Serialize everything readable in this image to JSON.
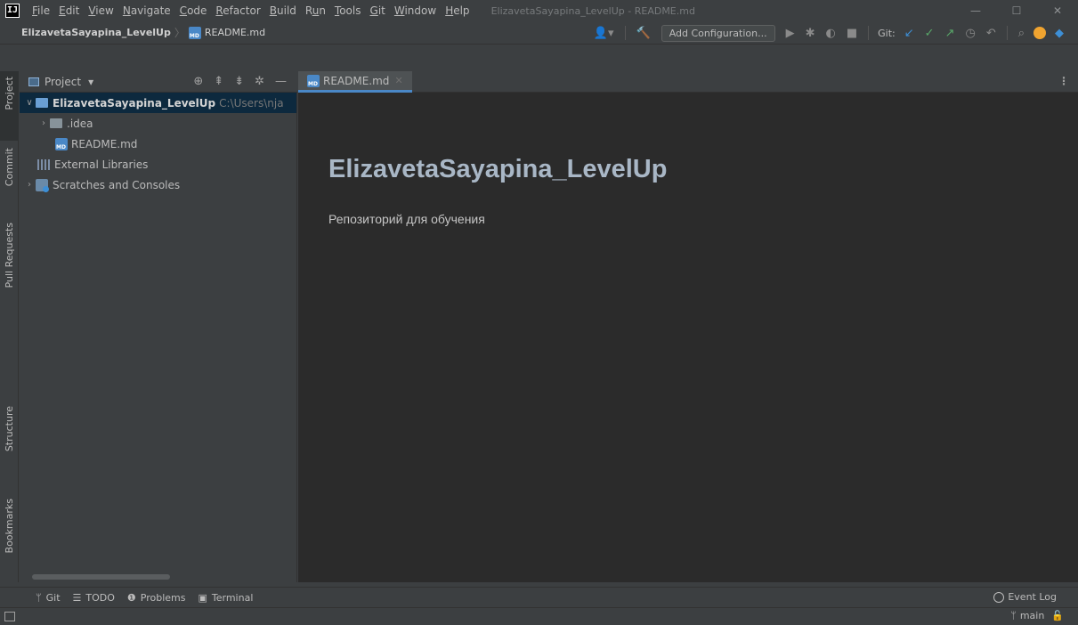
{
  "window": {
    "title": "ElizavetaSayapina_LevelUp - README.md",
    "logo_text": "IJ",
    "controls": [
      "—",
      "☐",
      "✕"
    ]
  },
  "menu": [
    {
      "key": "F",
      "rest": "ile"
    },
    {
      "key": "E",
      "rest": "dit"
    },
    {
      "key": "V",
      "rest": "iew"
    },
    {
      "key": "N",
      "rest": "avigate"
    },
    {
      "key": "C",
      "rest": "ode"
    },
    {
      "key": "R",
      "rest": "efactor"
    },
    {
      "key": "B",
      "rest": "uild"
    },
    {
      "pre": "R",
      "key": "u",
      "rest": "n"
    },
    {
      "key": "T",
      "rest": "ools"
    },
    {
      "key": "G",
      "rest": "it"
    },
    {
      "key": "W",
      "rest": "indow"
    },
    {
      "key": "H",
      "rest": "elp"
    }
  ],
  "navbar": {
    "project": "ElizavetaSayapina_LevelUp",
    "file": "README.md",
    "add_configuration": "Add Configuration...",
    "git_label": "Git:"
  },
  "left_stripe": {
    "project": "Project",
    "commit": "Commit",
    "pull_requests": "Pull Requests",
    "structure": "Structure",
    "bookmarks": "Bookmarks"
  },
  "project_panel": {
    "title": "Project",
    "root_name": "ElizavetaSayapina_LevelUp",
    "root_path": "C:\\Users\\nja",
    "items": [
      {
        "label": ".idea"
      },
      {
        "label": "README.md"
      },
      {
        "label": "External Libraries"
      },
      {
        "label": "Scratches and Consoles"
      }
    ]
  },
  "editor": {
    "tab_label": "README.md",
    "heading": "ElizavetaSayapina_LevelUp",
    "paragraph": "Репозиторий для обучения"
  },
  "bottom_bar": {
    "git": "Git",
    "todo": "TODO",
    "problems": "Problems",
    "terminal": "Terminal",
    "event_log": "Event Log"
  },
  "status_bar": {
    "branch": "main"
  },
  "colors": {
    "accent": "#4a88c7",
    "editor_bg": "#2b2b2b",
    "panel_bg": "#3c3f41",
    "selected_bg": "#0d293e"
  }
}
